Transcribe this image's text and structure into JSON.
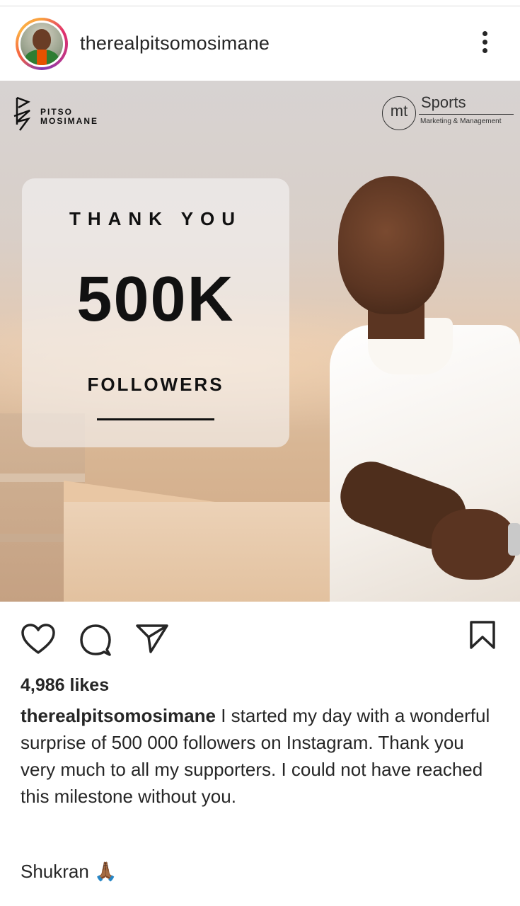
{
  "header": {
    "username": "therealpitsomosimane",
    "more_icon": "more-vertical-icon"
  },
  "post": {
    "logo_left": {
      "line1": "PITSO",
      "line2": "MOSIMANE"
    },
    "logo_right": {
      "mark": "mt",
      "name": "Sports",
      "tagline": "Marketing & Management"
    },
    "card": {
      "line1": "THANK YOU",
      "number": "500K",
      "line2": "FOLLOWERS"
    }
  },
  "actions": {
    "like_icon": "heart-icon",
    "comment_icon": "comment-icon",
    "share_icon": "send-icon",
    "save_icon": "bookmark-icon"
  },
  "likes": "4,986 likes",
  "caption": {
    "username": "therealpitsomosimane",
    "text": " I started my day with a wonderful surprise of 500 000 followers on Instagram. Thank you very much to all my supporters. I could not have reached this milestone without you.",
    "sign_off": "Shukran 🙏🏾"
  },
  "colors": {
    "text": "#262626",
    "divider": "#dbdbdb"
  }
}
